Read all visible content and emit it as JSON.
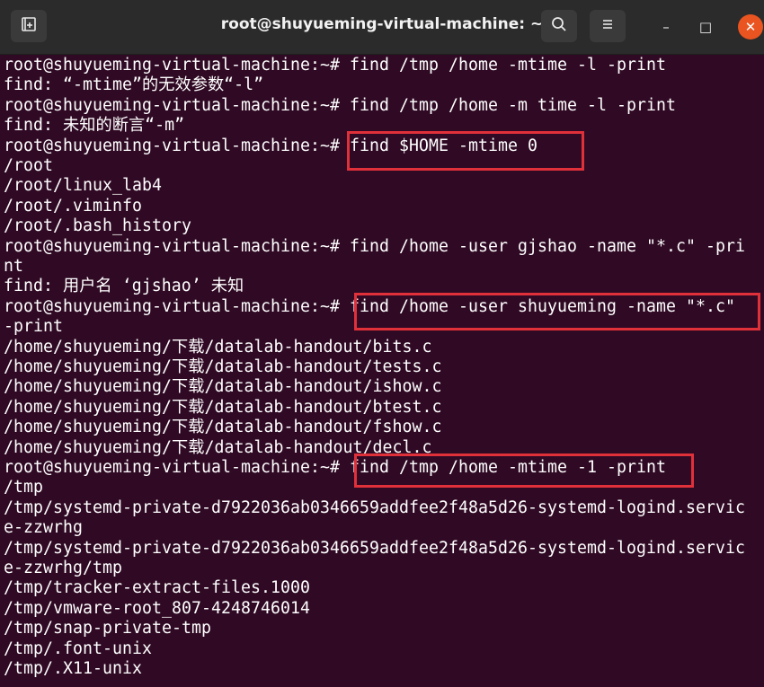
{
  "window": {
    "title": "root@shuyueming-virtual-machine: ~",
    "new_tab_icon": "new-tab-icon",
    "search_icon": "search-icon",
    "menu_icon": "hamburger-menu-icon",
    "minimize": "–",
    "maximize": "□",
    "close": "✕"
  },
  "terminal": {
    "lines": [
      "root@shuyueming-virtual-machine:~# find /tmp /home -mtime -l -print",
      "find: “-mtime”的无效参数“-l”",
      "root@shuyueming-virtual-machine:~# find /tmp /home -m time -l -print",
      "find: 未知的断言“-m”",
      "root@shuyueming-virtual-machine:~# find $HOME -mtime 0",
      "/root",
      "/root/linux_lab4",
      "/root/.viminfo",
      "/root/.bash_history",
      "root@shuyueming-virtual-machine:~# find /home -user gjshao -name \"*.c\" -pri",
      "nt",
      "find: 用户名 ‘gjshao’ 未知",
      "root@shuyueming-virtual-machine:~# find /home -user shuyueming -name \"*.c\"",
      "-print",
      "/home/shuyueming/下载/datalab-handout/bits.c",
      "/home/shuyueming/下载/datalab-handout/tests.c",
      "/home/shuyueming/下载/datalab-handout/ishow.c",
      "/home/shuyueming/下载/datalab-handout/btest.c",
      "/home/shuyueming/下载/datalab-handout/fshow.c",
      "/home/shuyueming/下载/datalab-handout/decl.c",
      "root@shuyueming-virtual-machine:~# find /tmp /home -mtime -1 -print",
      "/tmp",
      "/tmp/systemd-private-d7922036ab0346659addfee2f48a5d26-systemd-logind.servic",
      "e-zzwrhg",
      "/tmp/systemd-private-d7922036ab0346659addfee2f48a5d26-systemd-logind.servic",
      "e-zzwrhg/tmp",
      "/tmp/tracker-extract-files.1000",
      "/tmp/vmware-root_807-4248746014",
      "/tmp/snap-private-tmp",
      "/tmp/.font-unix",
      "/tmp/.X11-unix"
    ]
  }
}
